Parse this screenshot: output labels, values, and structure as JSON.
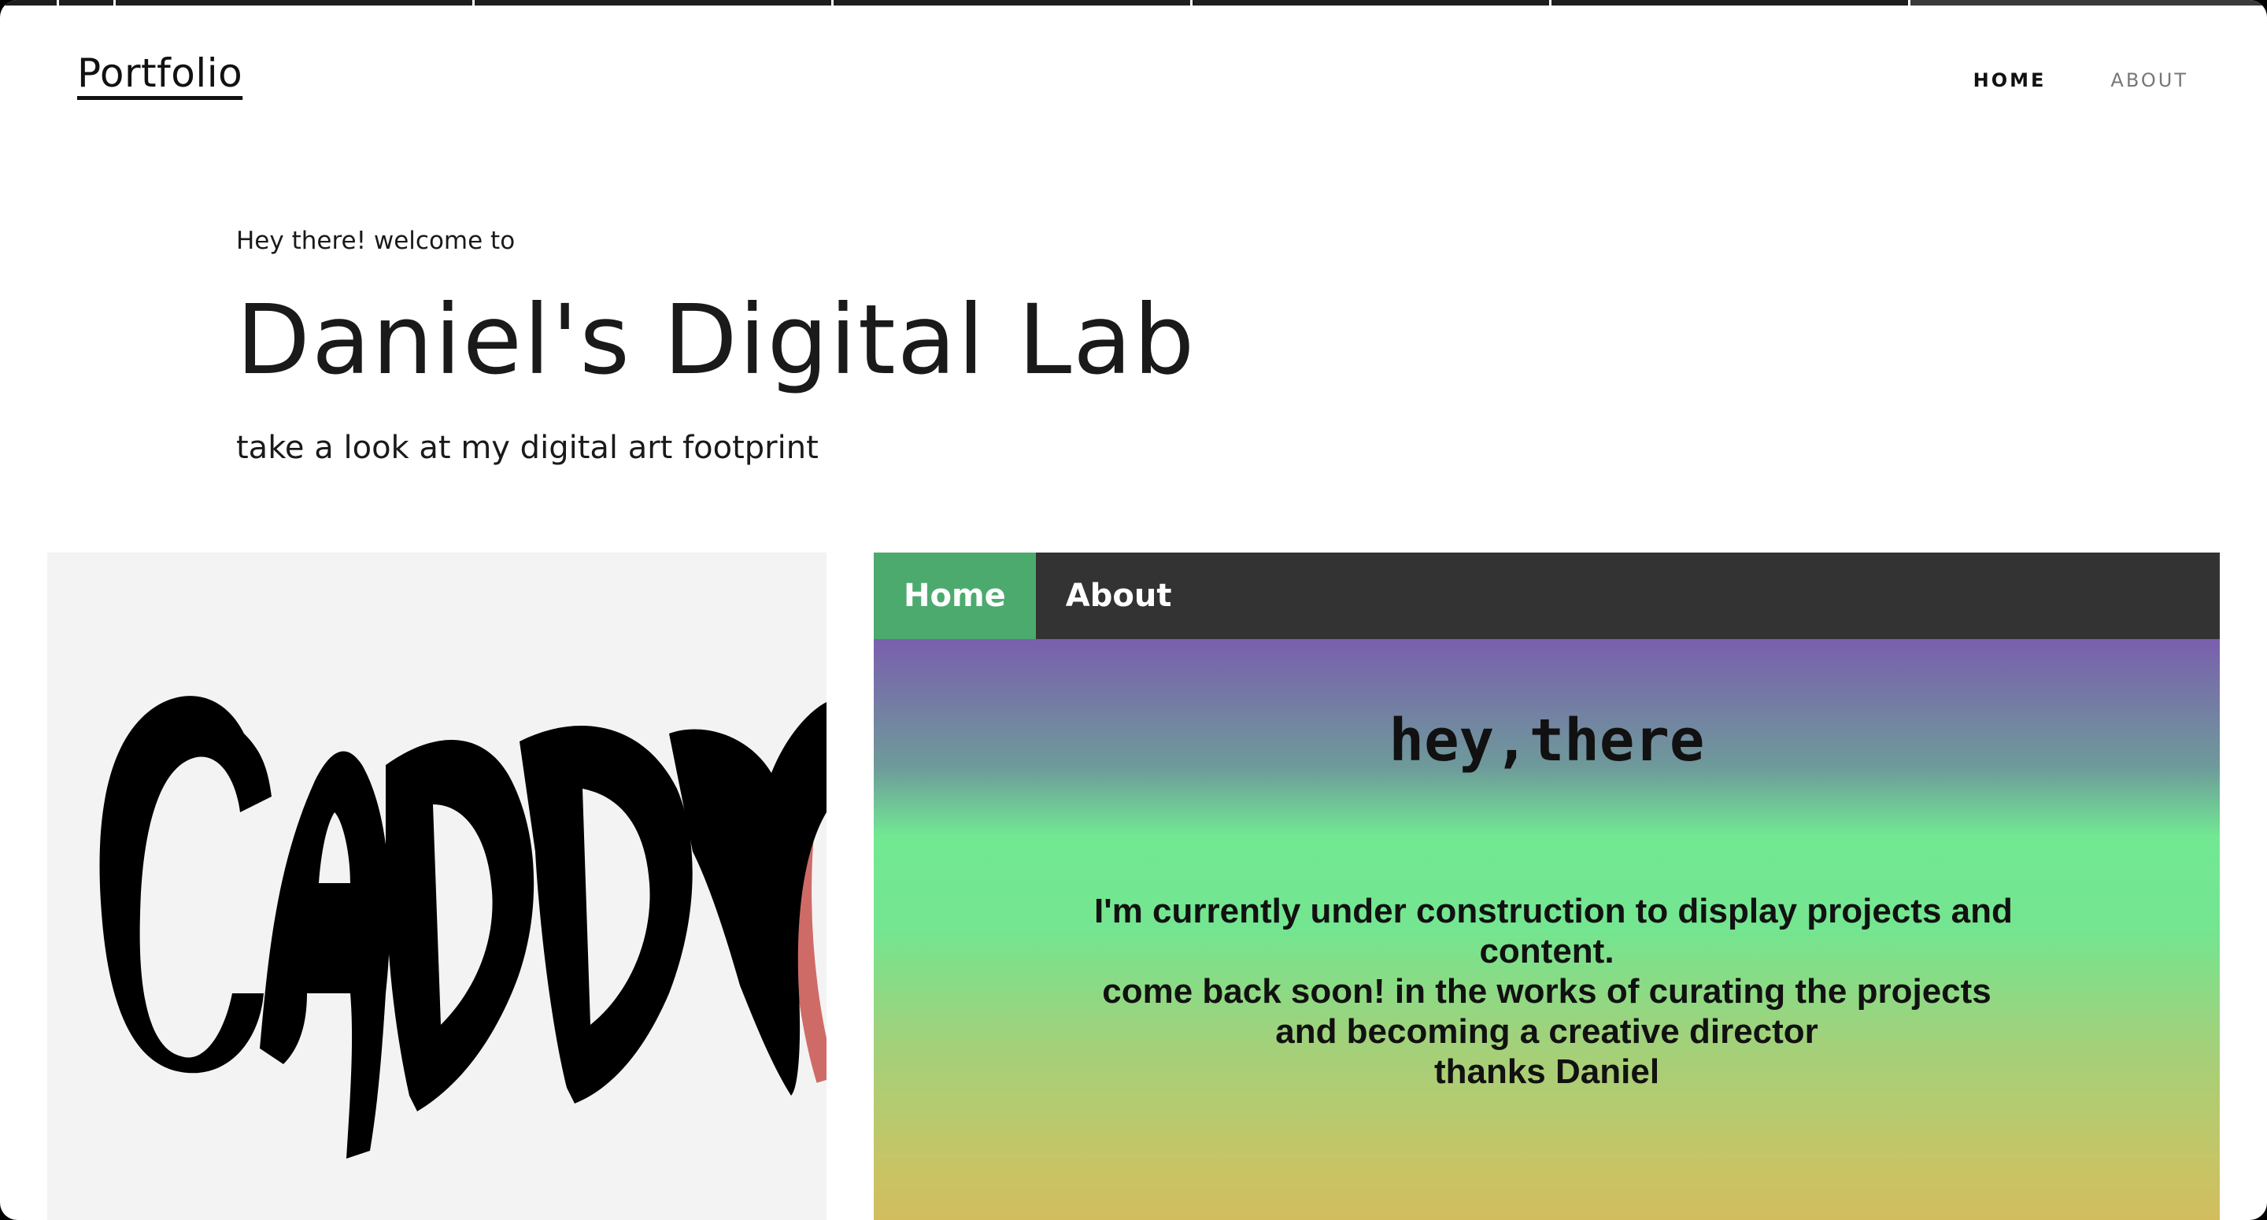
{
  "header": {
    "brand": "Portfolio",
    "nav": [
      {
        "label": "HOME",
        "active": true
      },
      {
        "label": "ABOUT",
        "active": false
      }
    ]
  },
  "hero": {
    "kicker": "Hey there! welcome to",
    "title": "Daniel's Digital Lab",
    "subtitle": "take a look at my digital art footprint"
  },
  "gallery": {
    "left_card": {
      "artwork_lettering": "CADDY",
      "background": "#f3f3f3",
      "accent": "#cf6b67"
    },
    "right_card": {
      "nav": [
        {
          "label": "Home",
          "active": true
        },
        {
          "label": "About",
          "active": false
        }
      ],
      "heading": "hey,there",
      "body_lines": [
        "I'm currently under construction to display projects and",
        "content.",
        "come back soon! in the works of curating the projects",
        "and becoming a creative director",
        "thanks Daniel"
      ],
      "colors": {
        "nav_bg": "#333333",
        "nav_active": "#4caa6f",
        "gradient_top": "#7a5fae",
        "gradient_mid": "#74e590",
        "gradient_bottom": "#d2bd5e"
      }
    }
  }
}
